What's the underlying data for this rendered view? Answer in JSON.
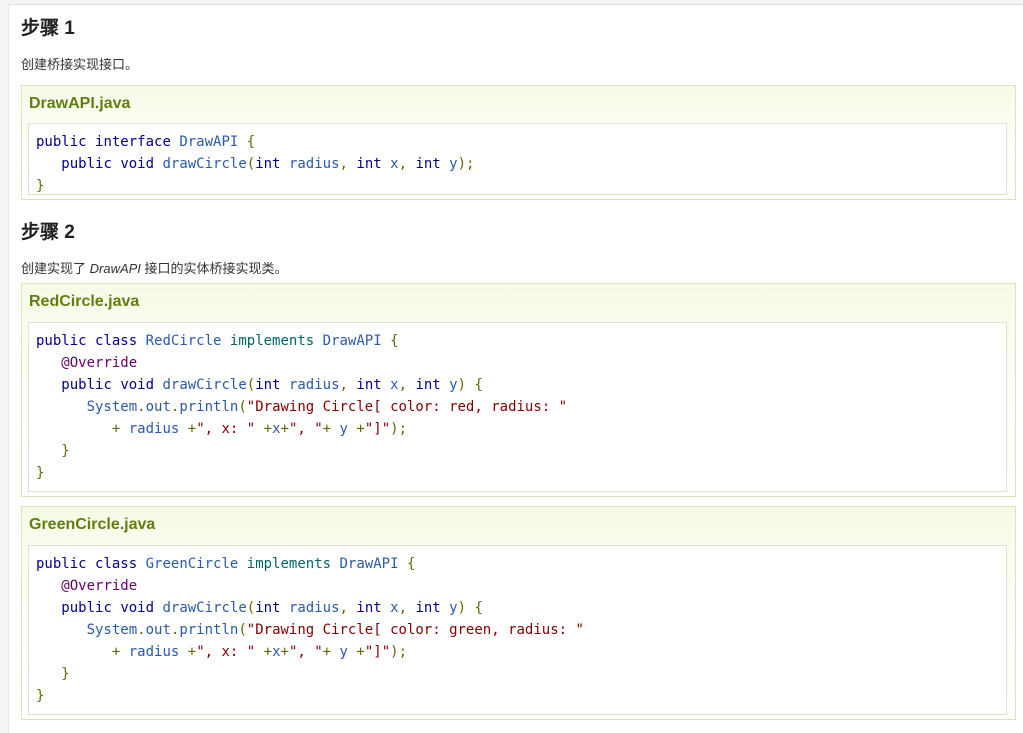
{
  "step1": {
    "title": "步骤 1",
    "desc": "创建桥接实现接口。",
    "file": {
      "name": "DrawAPI.java",
      "lines": [
        [
          [
            "kwd",
            "public"
          ],
          [
            "pln",
            " "
          ],
          [
            "kwd",
            "interface"
          ],
          [
            "pln",
            " "
          ],
          [
            "typ",
            "DrawAPI"
          ],
          [
            "pln",
            " "
          ],
          [
            "pun",
            "{"
          ]
        ],
        [
          [
            "pln",
            "   "
          ],
          [
            "kwd",
            "public"
          ],
          [
            "pln",
            " "
          ],
          [
            "kwd",
            "void"
          ],
          [
            "pln",
            " "
          ],
          [
            "typ",
            "drawCircle"
          ],
          [
            "pun",
            "("
          ],
          [
            "kwd",
            "int"
          ],
          [
            "pln",
            " "
          ],
          [
            "typ",
            "radius"
          ],
          [
            "pun",
            ","
          ],
          [
            "pln",
            " "
          ],
          [
            "kwd",
            "int"
          ],
          [
            "pln",
            " "
          ],
          [
            "typ",
            "x"
          ],
          [
            "pun",
            ","
          ],
          [
            "pln",
            " "
          ],
          [
            "kwd",
            "int"
          ],
          [
            "pln",
            " "
          ],
          [
            "typ",
            "y"
          ],
          [
            "pun",
            ");"
          ]
        ],
        [
          [
            "pun",
            "}"
          ]
        ]
      ]
    }
  },
  "step2": {
    "title": "步骤 2",
    "desc_before": "创建实现了 ",
    "desc_em": "DrawAPI",
    "desc_after": " 接口的实体桥接实现类。",
    "file1": {
      "name": "RedCircle.java",
      "lines": [
        [
          [
            "kwd",
            "public"
          ],
          [
            "pln",
            " "
          ],
          [
            "kwd",
            "class"
          ],
          [
            "pln",
            " "
          ],
          [
            "typ",
            "RedCircle"
          ],
          [
            "pln",
            " "
          ],
          [
            "lit",
            "implements"
          ],
          [
            "pln",
            " "
          ],
          [
            "typ",
            "DrawAPI"
          ],
          [
            "pln",
            " "
          ],
          [
            "pun",
            "{"
          ]
        ],
        [
          [
            "pln",
            "   "
          ],
          [
            "ann",
            "@Override"
          ]
        ],
        [
          [
            "pln",
            "   "
          ],
          [
            "kwd",
            "public"
          ],
          [
            "pln",
            " "
          ],
          [
            "kwd",
            "void"
          ],
          [
            "pln",
            " "
          ],
          [
            "typ",
            "drawCircle"
          ],
          [
            "pun",
            "("
          ],
          [
            "kwd",
            "int"
          ],
          [
            "pln",
            " "
          ],
          [
            "typ",
            "radius"
          ],
          [
            "pun",
            ","
          ],
          [
            "pln",
            " "
          ],
          [
            "kwd",
            "int"
          ],
          [
            "pln",
            " "
          ],
          [
            "typ",
            "x"
          ],
          [
            "pun",
            ","
          ],
          [
            "pln",
            " "
          ],
          [
            "kwd",
            "int"
          ],
          [
            "pln",
            " "
          ],
          [
            "typ",
            "y"
          ],
          [
            "pun",
            ")"
          ],
          [
            "pln",
            " "
          ],
          [
            "pun",
            "{"
          ]
        ],
        [
          [
            "pln",
            "      "
          ],
          [
            "typ",
            "System"
          ],
          [
            "pun",
            "."
          ],
          [
            "typ",
            "out"
          ],
          [
            "pun",
            "."
          ],
          [
            "typ",
            "println"
          ],
          [
            "pun",
            "("
          ],
          [
            "str",
            "\"Drawing Circle[ color: red, radius: \""
          ]
        ],
        [
          [
            "pln",
            "         "
          ],
          [
            "pun",
            "+"
          ],
          [
            "pln",
            " "
          ],
          [
            "typ",
            "radius"
          ],
          [
            "pln",
            " "
          ],
          [
            "pun",
            "+"
          ],
          [
            "str",
            "\", x: \""
          ],
          [
            "pln",
            " "
          ],
          [
            "pun",
            "+"
          ],
          [
            "typ",
            "x"
          ],
          [
            "pun",
            "+"
          ],
          [
            "str",
            "\", \""
          ],
          [
            "pun",
            "+"
          ],
          [
            "pln",
            " "
          ],
          [
            "typ",
            "y"
          ],
          [
            "pln",
            " "
          ],
          [
            "pun",
            "+"
          ],
          [
            "str",
            "\"]\""
          ],
          [
            "pun",
            ");"
          ]
        ],
        [
          [
            "pln",
            "   "
          ],
          [
            "pun",
            "}"
          ]
        ],
        [
          [
            "pun",
            "}"
          ]
        ]
      ]
    },
    "file2": {
      "name": "GreenCircle.java",
      "lines": [
        [
          [
            "kwd",
            "public"
          ],
          [
            "pln",
            " "
          ],
          [
            "kwd",
            "class"
          ],
          [
            "pln",
            " "
          ],
          [
            "typ",
            "GreenCircle"
          ],
          [
            "pln",
            " "
          ],
          [
            "lit",
            "implements"
          ],
          [
            "pln",
            " "
          ],
          [
            "typ",
            "DrawAPI"
          ],
          [
            "pln",
            " "
          ],
          [
            "pun",
            "{"
          ]
        ],
        [
          [
            "pln",
            "   "
          ],
          [
            "ann",
            "@Override"
          ]
        ],
        [
          [
            "pln",
            "   "
          ],
          [
            "kwd",
            "public"
          ],
          [
            "pln",
            " "
          ],
          [
            "kwd",
            "void"
          ],
          [
            "pln",
            " "
          ],
          [
            "typ",
            "drawCircle"
          ],
          [
            "pun",
            "("
          ],
          [
            "kwd",
            "int"
          ],
          [
            "pln",
            " "
          ],
          [
            "typ",
            "radius"
          ],
          [
            "pun",
            ","
          ],
          [
            "pln",
            " "
          ],
          [
            "kwd",
            "int"
          ],
          [
            "pln",
            " "
          ],
          [
            "typ",
            "x"
          ],
          [
            "pun",
            ","
          ],
          [
            "pln",
            " "
          ],
          [
            "kwd",
            "int"
          ],
          [
            "pln",
            " "
          ],
          [
            "typ",
            "y"
          ],
          [
            "pun",
            ")"
          ],
          [
            "pln",
            " "
          ],
          [
            "pun",
            "{"
          ]
        ],
        [
          [
            "pln",
            "      "
          ],
          [
            "typ",
            "System"
          ],
          [
            "pun",
            "."
          ],
          [
            "typ",
            "out"
          ],
          [
            "pun",
            "."
          ],
          [
            "typ",
            "println"
          ],
          [
            "pun",
            "("
          ],
          [
            "str",
            "\"Drawing Circle[ color: green, radius: \""
          ]
        ],
        [
          [
            "pln",
            "         "
          ],
          [
            "pun",
            "+"
          ],
          [
            "pln",
            " "
          ],
          [
            "typ",
            "radius"
          ],
          [
            "pln",
            " "
          ],
          [
            "pun",
            "+"
          ],
          [
            "str",
            "\", x: \""
          ],
          [
            "pln",
            " "
          ],
          [
            "pun",
            "+"
          ],
          [
            "typ",
            "x"
          ],
          [
            "pun",
            "+"
          ],
          [
            "str",
            "\", \""
          ],
          [
            "pun",
            "+"
          ],
          [
            "pln",
            " "
          ],
          [
            "typ",
            "y"
          ],
          [
            "pln",
            " "
          ],
          [
            "pun",
            "+"
          ],
          [
            "str",
            "\"]\""
          ],
          [
            "pun",
            ");"
          ]
        ],
        [
          [
            "pln",
            "   "
          ],
          [
            "pun",
            "}"
          ]
        ],
        [
          [
            "pun",
            "}"
          ]
        ]
      ]
    }
  }
}
